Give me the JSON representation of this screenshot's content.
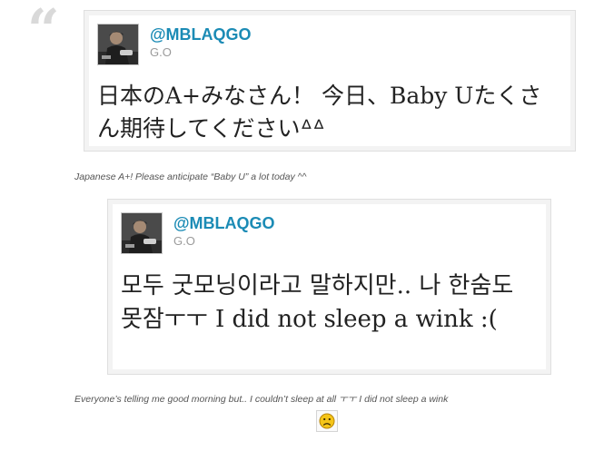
{
  "tweets": [
    {
      "handle": "@MBLAQGO",
      "display_name": "G.O",
      "text": "日本のA+みなさん！ 今日、Baby Uたくさん期待してくださいᐞᐞ",
      "caption": "Japanese A+! Please anticipate “Baby U” a lot today ^^"
    },
    {
      "handle": "@MBLAQGO",
      "display_name": "G.O",
      "text": "모두 굿모닝이라고 말하지만.. 나 한숨도 못잠ㅜㅜ I did not sleep a wink :(",
      "caption": "Everyone’s telling me good morning but.. I couldn’t sleep at all ㅜㅜ I did not sleep a wink"
    }
  ],
  "icons": {
    "quote": "quote-mark-icon",
    "avatar": "profile-photo",
    "emoticon": "sad-face-icon"
  },
  "colors": {
    "handle": "#1b8bb5",
    "display_name": "#9a9a9a",
    "tweet_text": "#222222",
    "caption": "#555555",
    "quote_mark": "#d9d9d9",
    "emoticon_fill": "#f5c518"
  }
}
